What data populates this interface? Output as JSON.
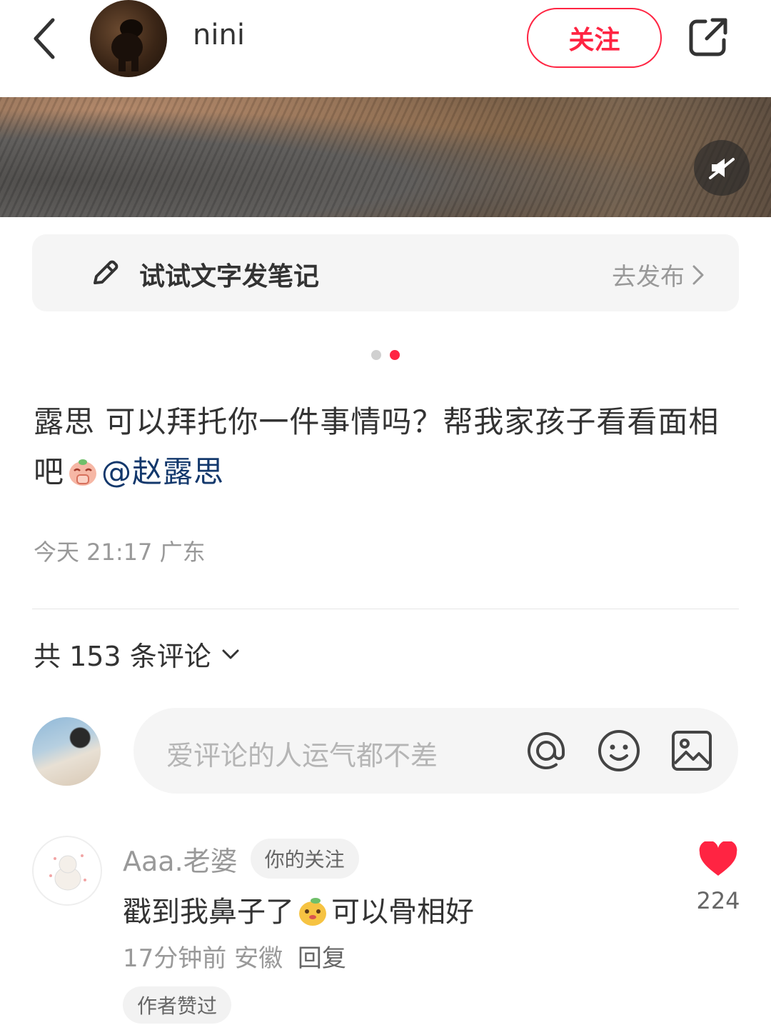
{
  "header": {
    "author_name": "nini",
    "follow_label": "关注"
  },
  "prompt": {
    "text": "试试文字发笔记",
    "action": "去发布"
  },
  "pagination": {
    "total": 2,
    "active": 2
  },
  "caption": {
    "text": "露思 可以拜托你一件事情吗？帮我家孩子看看面相吧",
    "mention": "@赵露思"
  },
  "meta": {
    "time": "今天 21:17",
    "location": "广东"
  },
  "comments": {
    "count_label": "共 153 条评论",
    "input_placeholder": "爱评论的人运气都不差"
  },
  "comment": {
    "username": "Aaa.老婆",
    "badge": "你的关注",
    "text_before": "戳到我鼻子了",
    "text_after": "可以骨相好",
    "time": "17分钟前",
    "location": "安徽",
    "reply_label": "回复",
    "author_liked": "作者赞过",
    "like_count": "224"
  },
  "colors": {
    "accent": "#ff2442",
    "mention": "#13386c"
  },
  "icons": [
    "back-icon",
    "share-icon",
    "mute-icon",
    "pencil-icon",
    "chevron-right-icon",
    "chevron-down-icon",
    "at-icon",
    "emoji-icon",
    "image-icon",
    "heart-icon"
  ]
}
